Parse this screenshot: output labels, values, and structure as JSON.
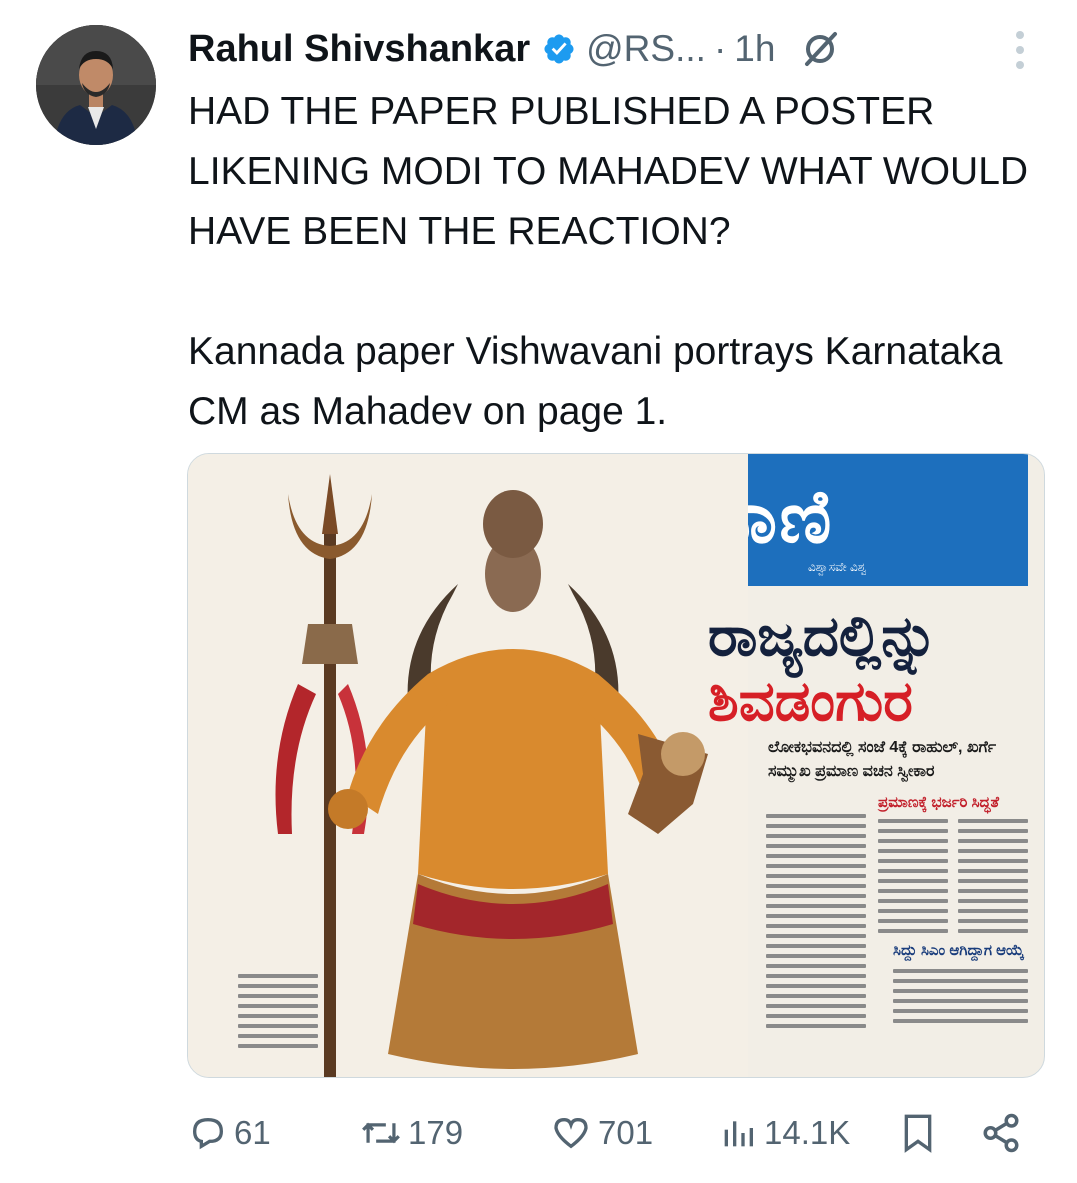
{
  "tweet": {
    "author_name": "Rahul Shivshankar",
    "handle": "@RS...",
    "dot": "·",
    "time": "1h",
    "text": "HAD THE PAPER PUBLISHED A POSTER LIKENING MODI TO MAHADEV WHAT WOULD HAVE BEEN THE REACTION?\n\nKannada paper Vishwavani portrays Karnataka CM as Mahadev on page 1."
  },
  "media": {
    "masthead": "ವಿಶ್ವವಾಣಿ",
    "masthead_sub": "ವಿಶ್ವಾಸವೇ ವಿಶ್ವ",
    "headline_line1": "ರಾಜ್ಯದಲ್ಲಿನ್ನು",
    "headline_line2": "ಶಿವಡಂಗುರ",
    "subhead": "ಲೋಕಭವನದಲ್ಲಿ ಸಂಜೆ 4ಕ್ಕೆ ರಾಹುಲ್, ಖರ್ಗೆ ಸಮ್ಮುಖ ಪ್ರಮಾಣ ವಚನ ಸ್ವೀಕಾರ",
    "box_title_1": "ಪ್ರಮಾಣಕ್ಕೆ ಭರ್ಜರಿ ಸಿದ್ಧತೆ",
    "box_title_2": "ಸಿದ್ದು ಸಿಎಂ ಆಗಿದ್ದಾಗ ಆಯ್ಕೆ"
  },
  "actions": {
    "replies": "61",
    "reposts": "179",
    "likes": "701",
    "views": "14.1K"
  },
  "colors": {
    "verified": "#1d9bf0",
    "secondary_text": "#536471",
    "masthead_blue": "#1d6fbd",
    "headline_red": "#d61f26"
  }
}
